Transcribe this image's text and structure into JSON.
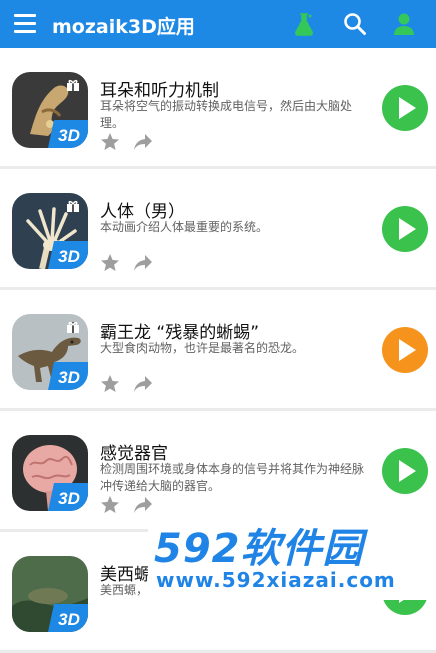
{
  "header": {
    "title": "mozaik3D应用",
    "icons": [
      "menu-icon",
      "lab-flask-icon",
      "search-icon",
      "account-icon"
    ],
    "bar_color": "#1e88e5"
  },
  "items": [
    {
      "title": "耳朵和听力机制",
      "desc": "耳朵将空气的振动转换成电信号，然后由大脑处理。",
      "badge": "3D",
      "play_color": "#3ac24d"
    },
    {
      "title": "人体（男）",
      "desc": "本动画介绍人体最重要的系统。",
      "badge": "3D",
      "play_color": "#3ac24d"
    },
    {
      "title": "霸王龙 “残暴的蜥蜴”",
      "desc": "大型食肉动物，也许是最著名的恐龙。",
      "badge": "3D",
      "play_color": "#f5931d"
    },
    {
      "title": "感觉器官",
      "desc": "检测周围环境或身体本身的信号并将其作为神经脉冲传递给大脑的器官。",
      "badge": "3D",
      "play_color": "#3ac24d"
    },
    {
      "title": "美西螈",
      "desc": "美西螈，",
      "badge": "3D",
      "play_color": "#3ac24d"
    }
  ],
  "watermark": {
    "logo": "592软件园",
    "url": "www.592xiazai.com"
  }
}
